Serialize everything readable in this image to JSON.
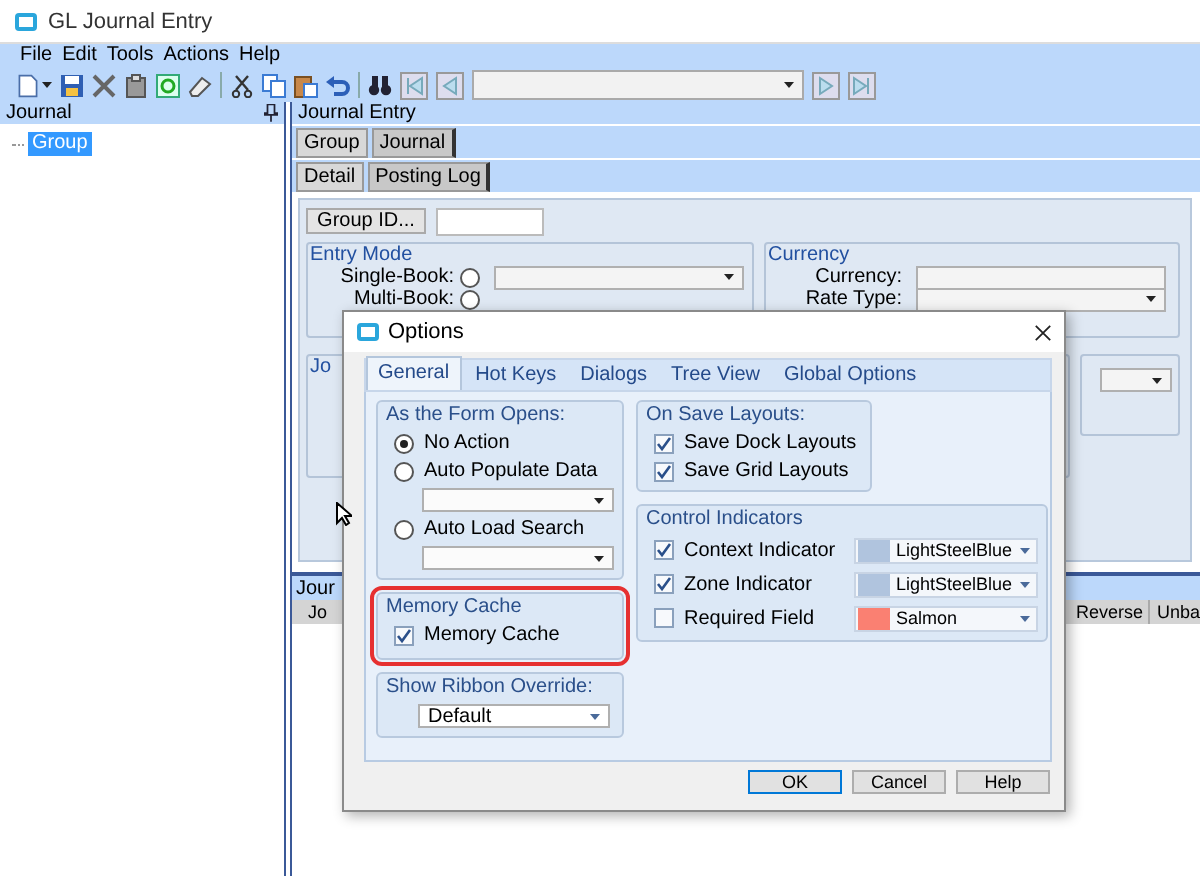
{
  "window": {
    "title": "GL Journal Entry"
  },
  "menu": [
    {
      "label": "File"
    },
    {
      "label": "Edit"
    },
    {
      "label": "Tools"
    },
    {
      "label": "Actions"
    },
    {
      "label": "Help"
    }
  ],
  "journal_panel": {
    "title": "Journal",
    "tree": [
      {
        "label": "Group",
        "selected": true
      }
    ]
  },
  "journal_entry": {
    "title": "Journal Entry",
    "tabs": [
      {
        "label": "Group",
        "selected": true
      },
      {
        "label": "Journal",
        "selected": false
      }
    ],
    "subtabs": [
      {
        "label": "Detail",
        "selected": true
      },
      {
        "label": "Posting Log",
        "selected": false
      }
    ],
    "group_id_button": "Group ID...",
    "entry_mode": {
      "title": "Entry Mode",
      "options": [
        {
          "label": "Single-Book:",
          "selected": false
        },
        {
          "label": "Multi-Book:",
          "selected": false
        }
      ]
    },
    "currency": {
      "title": "Currency",
      "fields": [
        {
          "label": "Currency:"
        },
        {
          "label": "Rate Type:"
        }
      ]
    },
    "journal_group": {
      "title": "Jo"
    },
    "grid": {
      "title": "Jour",
      "columns": [
        {
          "label": "Jo"
        },
        {
          "label": "Reverse"
        },
        {
          "label": "Unba"
        }
      ]
    }
  },
  "dialog": {
    "title": "Options",
    "tabs": [
      {
        "label": "General",
        "selected": true
      },
      {
        "label": "Hot Keys",
        "selected": false
      },
      {
        "label": "Dialogs",
        "selected": false
      },
      {
        "label": "Tree View",
        "selected": false
      },
      {
        "label": "Global Options",
        "selected": false
      }
    ],
    "form_opens": {
      "title": "As the Form Opens:",
      "options": [
        {
          "label": "No Action",
          "selected": true
        },
        {
          "label": "Auto Populate Data",
          "selected": false
        },
        {
          "label": "Auto Load Search",
          "selected": false
        }
      ]
    },
    "memory_cache": {
      "title": "Memory Cache",
      "highlighted": true,
      "label": "Memory Cache",
      "checked": true
    },
    "ribbon": {
      "title": "Show Ribbon Override:",
      "value": "Default"
    },
    "save_layouts": {
      "title": "On Save Layouts:",
      "options": [
        {
          "label": "Save Dock Layouts",
          "checked": true
        },
        {
          "label": "Save Grid Layouts",
          "checked": true
        }
      ]
    },
    "indicators": {
      "title": "Control Indicators",
      "rows": [
        {
          "label": "Context Indicator",
          "checked": true,
          "color": "#b0c4de",
          "value": "LightSteelBlue"
        },
        {
          "label": "Zone Indicator",
          "checked": true,
          "color": "#b0c4de",
          "value": "LightSteelBlue"
        },
        {
          "label": "Required Field",
          "checked": false,
          "color": "#fa8072",
          "value": "Salmon"
        }
      ]
    },
    "buttons": [
      {
        "label": "OK",
        "default": true
      },
      {
        "label": "Cancel",
        "default": false
      },
      {
        "label": "Help",
        "default": false
      }
    ]
  }
}
